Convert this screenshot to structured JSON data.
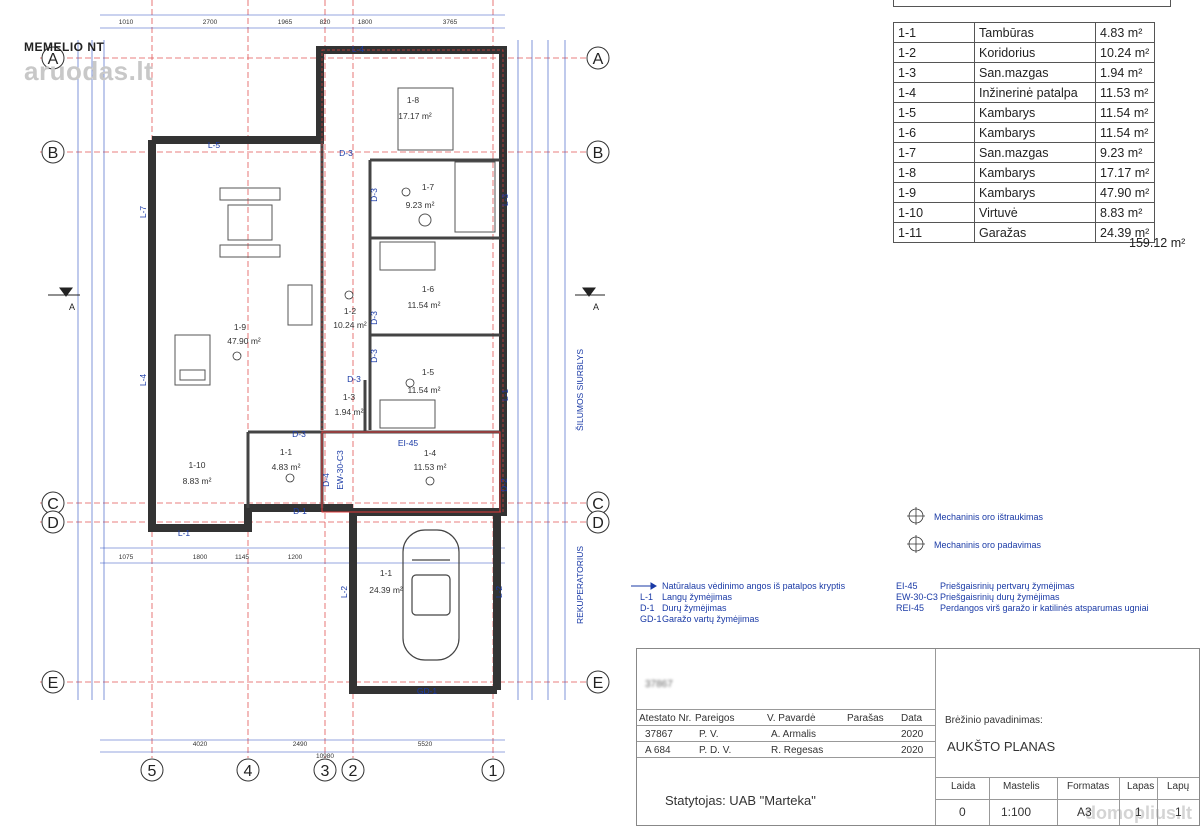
{
  "watermark": {
    "brand": "MEMELIO NT",
    "site": "aruodas.lt",
    "corner": "domoplius.lt"
  },
  "axis_labels": {
    "rows": [
      "A",
      "B",
      "C",
      "D",
      "E"
    ],
    "cols": [
      "5",
      "4",
      "3",
      "2",
      "1"
    ],
    "section_mark": "A"
  },
  "rooms": [
    {
      "num": "1-1",
      "name": "Tambūras",
      "area": "4.83 m²"
    },
    {
      "num": "1-2",
      "name": "Koridorius",
      "area": "10.24 m²"
    },
    {
      "num": "1-3",
      "name": "San.mazgas",
      "area": "1.94 m²"
    },
    {
      "num": "1-4",
      "name": "Inžinerinė patalpa",
      "area": "11.53 m²"
    },
    {
      "num": "1-5",
      "name": "Kambarys",
      "area": "11.54 m²"
    },
    {
      "num": "1-6",
      "name": "Kambarys",
      "area": "11.54 m²"
    },
    {
      "num": "1-7",
      "name": "San.mazgas",
      "area": "9.23 m²"
    },
    {
      "num": "1-8",
      "name": "Kambarys",
      "area": "17.17 m²"
    },
    {
      "num": "1-9",
      "name": "Kambarys",
      "area": "47.90 m²"
    },
    {
      "num": "1-10",
      "name": "Virtuvė",
      "area": "8.83 m²"
    },
    {
      "num": "1-11",
      "name": "Garažas",
      "area": "24.39 m²"
    }
  ],
  "total_area": "159.12 m²",
  "plan_labels": {
    "r18": "1-8",
    "r18a": "17.17 m²",
    "r17": "1-7",
    "r17a": "9.23 m²",
    "r16": "1-6",
    "r16a": "11.54 m²",
    "r15": "1-5",
    "r15a": "11.54 m²",
    "r19": "1-9",
    "r19a": "47.90 m²",
    "r12": "1-2",
    "r12a": "10.24 m²",
    "r13": "1-3",
    "r13a": "1.94 m²",
    "r110": "1-10",
    "r110a": "8.83 m²",
    "r11": "1-1",
    "r11a": "4.83 m²",
    "r14": "1-4",
    "r14a": "11.53 m²",
    "r111": "1-1",
    "r111a": "24.39 m²",
    "L4": "L-4",
    "L5": "L-5",
    "L7": "L-7",
    "L4b": "L-4",
    "L1": "L-1",
    "L2a": "L-2",
    "L2b": "L-2",
    "L3": "L-3",
    "L1b": "L-1",
    "D3a": "D-3",
    "D3b": "D-3",
    "D3c": "D-3",
    "D3d": "D-3",
    "D3e": "D-3",
    "D3f": "D-3",
    "D1": "D-1",
    "D4": "D-4",
    "D2": "D-2",
    "EW": "EW-30-C3",
    "EI": "EI-45",
    "GD1": "GD-1",
    "pump": "ŠILUMOS SIURBLYS",
    "recup": "REKUPERATORIUS",
    "dims_top": [
      "1010",
      "2700",
      "1965",
      "820",
      "1800",
      "3765"
    ],
    "dims_bottom_row1": [
      "1075",
      "1800",
      "1145",
      "1200"
    ],
    "dims_bottom_row2": [
      "4020",
      "2490",
      "5520"
    ],
    "dims_bottom_total": "10980"
  },
  "legend_left": [
    {
      "key": "",
      "text": "Natūralaus vėdinimo angos iš patalpos  kryptis"
    },
    {
      "key": "L-1",
      "text": "Langų žymėjimas"
    },
    {
      "key": "D-1",
      "text": "Durų žymėjimas"
    },
    {
      "key": "GD-1",
      "text": "Garažo vartų žymėjimas"
    }
  ],
  "legend_right": [
    {
      "key": "EI-45",
      "text": "Priešgaisrinių pertvarų žymėjimas"
    },
    {
      "key": "EW-30-C3",
      "text": "Priešgaisrinių durų žymėjimas"
    },
    {
      "key": "REI-45",
      "text": "Perdangos virš garažo ir katilinės  atsparumas ugniai"
    }
  ],
  "mech": {
    "exhaust": "Mechaninis oro ištraukimas",
    "supply": "Mechaninis oro padavimas"
  },
  "title_block": {
    "header": [
      "Atestato Nr.",
      "Pareigos",
      "V. Pavardė",
      "Parašas",
      "Data"
    ],
    "rows": [
      [
        "37867",
        "P. V.",
        "A. Armalis",
        "",
        "2020"
      ],
      [
        "A 684",
        "P. D. V.",
        "R. Regesas",
        "",
        "2020"
      ]
    ],
    "brezinys": "Brėžinio pavadinimas:",
    "sheet_title": "AUKŠTO PLANAS",
    "client": "Statytojas: UAB \"Marteka\"",
    "footer_hdr": [
      "Laida",
      "Mastelis",
      "Formatas",
      "Lapas",
      "Lapų"
    ],
    "footer_val": [
      "0",
      "1:100",
      "A3",
      "1",
      "1"
    ]
  }
}
